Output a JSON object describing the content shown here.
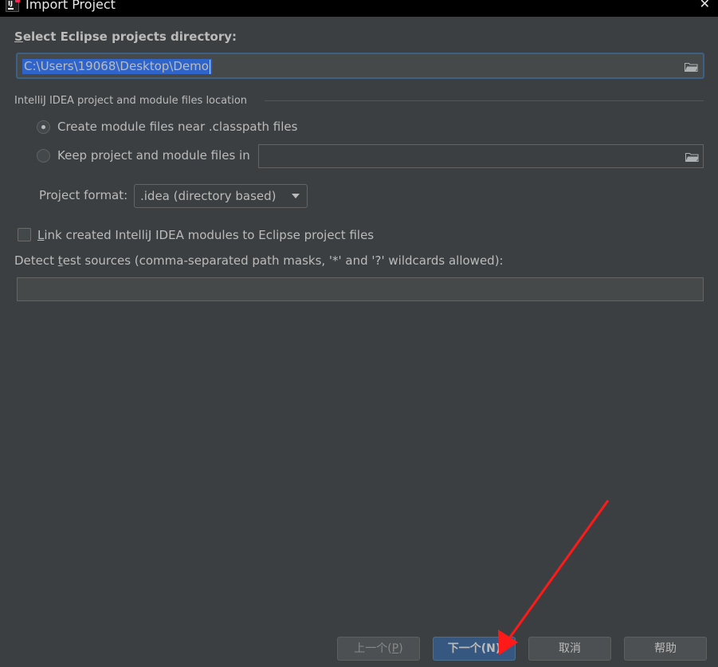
{
  "window": {
    "title": "Import Project",
    "close_glyph": "✕"
  },
  "directory": {
    "label_prefix": "S",
    "label_rest": "elect Eclipse projects directory:",
    "value": "C:\\Users\\19068\\Desktop\\Demo",
    "browse_icon": "folder-icon"
  },
  "location_group": {
    "title": "IntelliJ IDEA project and module files location",
    "options": [
      {
        "label": "Create module files near .classpath files",
        "selected": true
      },
      {
        "label": "Keep project and module files in",
        "selected": false
      }
    ],
    "keep_path_value": "",
    "browse_icon": "folder-icon"
  },
  "project_format": {
    "label": "Project format:",
    "value": ".idea (directory based)"
  },
  "link_modules": {
    "label_prefix": "L",
    "label_rest": "ink created IntelliJ IDEA modules to Eclipse project files",
    "checked": false
  },
  "detect_tests": {
    "label_before": "Detect ",
    "label_mnemonic": "t",
    "label_after": "est sources (comma-separated path masks, '*' and '?' wildcards allowed):",
    "value": ""
  },
  "buttons": {
    "previous": {
      "text": "上一个(",
      "mnemonic": "P",
      "close": ")"
    },
    "next": {
      "text": "下一个(N)"
    },
    "cancel": "取消",
    "help": "帮助"
  },
  "colors": {
    "background": "#3c3f41",
    "titlebar": "#000000",
    "selection": "#2f65ca",
    "focus_border": "#3d6185",
    "primary_button": "#365880",
    "annotation_arrow": "#ff1a1a"
  }
}
